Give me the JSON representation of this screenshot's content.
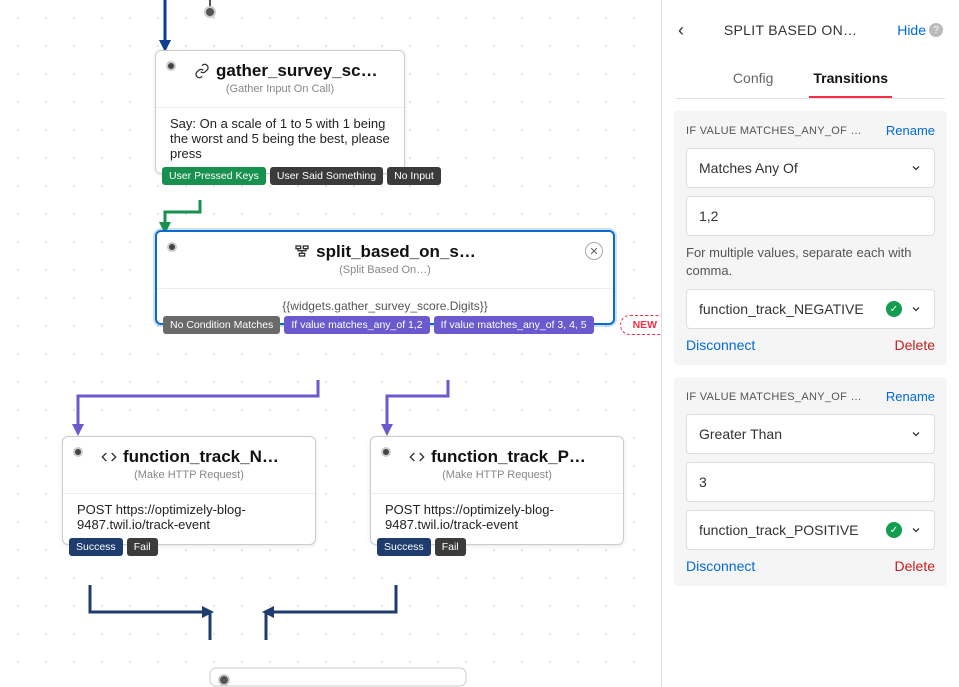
{
  "panel": {
    "title": "SPLIT BASED ON…",
    "hide": "Hide",
    "tabs": {
      "config": "Config",
      "transitions": "Transitions"
    }
  },
  "widgets": {
    "gather": {
      "title": "gather_survey_sc…",
      "subtitle": "(Gather Input On Call)",
      "body": "Say: On a scale of 1 to 5 with 1 being the worst and 5 being the best, please press",
      "chips": [
        "User Pressed Keys",
        "User Said Something",
        "No Input"
      ]
    },
    "split": {
      "title": "split_based_on_s…",
      "subtitle": "(Split Based On…)",
      "body": "{{widgets.gather_survey_score.Digits}}",
      "chips": [
        "No Condition Matches",
        "If value matches_any_of 1,2",
        "If value matches_any_of 3, 4, 5"
      ],
      "new": "NEW"
    },
    "neg": {
      "title": "function_track_N…",
      "subtitle": "(Make HTTP Request)",
      "body": "POST https://optimizely-blog-9487.twil.io/track-event",
      "chips": [
        "Success",
        "Fail"
      ]
    },
    "pos": {
      "title": "function_track_P…",
      "subtitle": "(Make HTTP Request)",
      "body": "POST https://optimizely-blog-9487.twil.io/track-event",
      "chips": [
        "Success",
        "Fail"
      ]
    }
  },
  "transitions": [
    {
      "header": "IF VALUE MATCHES_ANY_OF …",
      "rename": "Rename",
      "condition": "Matches Any Of",
      "value": "1,2",
      "helper": "For multiple values, separate each with comma.",
      "target": "function_track_NEGATIVE",
      "disconnect": "Disconnect",
      "delete": "Delete"
    },
    {
      "header": "IF VALUE MATCHES_ANY_OF …",
      "rename": "Rename",
      "condition": "Greater Than",
      "value": "3",
      "target": "function_track_POSITIVE",
      "disconnect": "Disconnect",
      "delete": "Delete"
    }
  ]
}
